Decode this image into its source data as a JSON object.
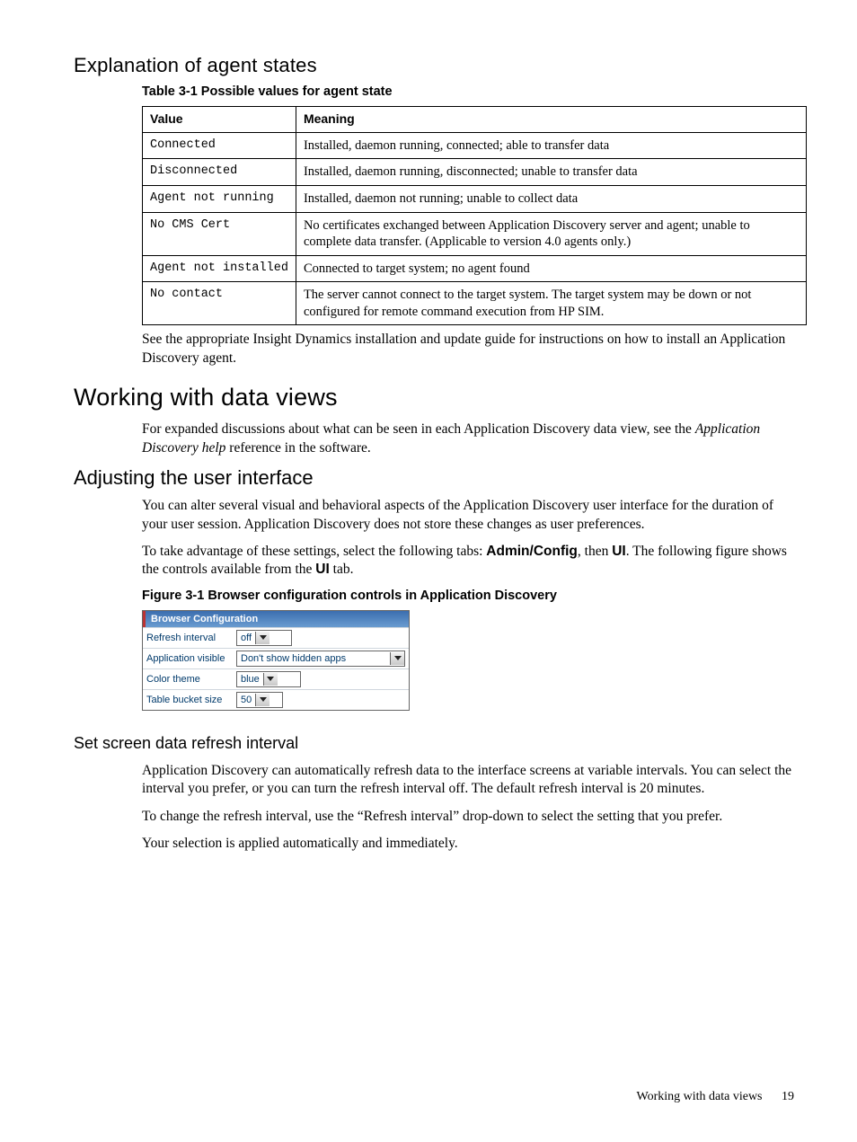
{
  "headings": {
    "h_agent_states": "Explanation of agent states",
    "table_caption": "Table 3-1 Possible values for agent state",
    "h_working": "Working with data views",
    "h_adjust_ui": "Adjusting the user interface",
    "figure_caption": "Figure 3-1 Browser configuration controls in Application Discovery",
    "h_refresh": "Set screen data refresh interval"
  },
  "table": {
    "head": {
      "c1": "Value",
      "c2": "Meaning"
    },
    "rows": [
      {
        "v": "Connected",
        "m": "Installed, daemon running, connected; able to transfer data"
      },
      {
        "v": "Disconnected",
        "m": "Installed, daemon running, disconnected; unable to transfer data"
      },
      {
        "v": "Agent not running",
        "m": "Installed, daemon not running; unable to collect data"
      },
      {
        "v": "No CMS Cert",
        "m": "No certificates exchanged between Application Discovery server and agent; unable to complete data transfer. (Applicable to version 4.0 agents only.)"
      },
      {
        "v": "Agent not installed",
        "m": "Connected to target system; no agent found"
      },
      {
        "v": "No contact",
        "m": "The server cannot connect to the target system. The target system may be down or not configured for remote command execution from HP SIM."
      }
    ]
  },
  "paras": {
    "after_table": "See the appropriate Insight Dynamics installation and update guide for instructions on how to install an Application Discovery agent.",
    "working_intro_a": "For expanded discussions about what can be seen in each Application Discovery data view, see the ",
    "working_intro_ref": "Application Discovery help",
    "working_intro_b": " reference in the software.",
    "adjust_1": "You can alter several visual and behavioral aspects of the Application Discovery user interface for the duration of your user session. Application Discovery does not store these changes as user preferences.",
    "adjust_2a": "To take advantage of these settings, select the following tabs: ",
    "adjust_2_admin": "Admin/Config",
    "adjust_2b": ", then ",
    "adjust_2_ui": "UI",
    "adjust_2c": ". The following figure shows the controls available from the ",
    "adjust_2_ui2": "UI",
    "adjust_2d": " tab.",
    "refresh_1": "Application Discovery can automatically refresh data to the interface screens at variable intervals. You can select the interval you prefer, or you can turn the refresh interval off. The default refresh interval is 20 minutes.",
    "refresh_2": "To change the refresh interval, use the “Refresh interval” drop-down to select the setting that you prefer.",
    "refresh_3": "Your selection is applied automatically and immediately."
  },
  "browser_config": {
    "title": "Browser Configuration",
    "rows": {
      "refresh_label": "Refresh interval",
      "refresh_value": "off",
      "appvis_label": "Application visible",
      "appvis_value": "Don't show hidden apps",
      "color_label": "Color theme",
      "color_value": "blue",
      "bucket_label": "Table bucket size",
      "bucket_value": "50"
    }
  },
  "footer": {
    "section": "Working with data views",
    "page": "19"
  }
}
